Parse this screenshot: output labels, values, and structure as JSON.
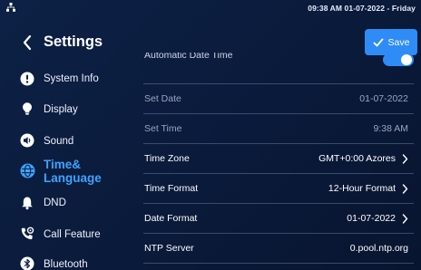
{
  "status_bar": {
    "network_icon": "network-icon",
    "datetime": "09:38 AM  01-07-2022 - Friday"
  },
  "header": {
    "back_icon": "chevron-left-icon",
    "title": "Settings",
    "save_label": "Save",
    "save_icon": "check-icon"
  },
  "sidebar": {
    "items": [
      {
        "label": "System Info",
        "icon": "info-icon"
      },
      {
        "label": "Display",
        "icon": "lightbulb-icon"
      },
      {
        "label": "Sound",
        "icon": "speaker-icon"
      },
      {
        "label": "Time& Language",
        "line1": "Time&",
        "line2": "Language",
        "icon": "globe-icon",
        "active": true
      },
      {
        "label": "DND",
        "icon": "bell-icon"
      },
      {
        "label": "Call Feature",
        "icon": "phone-settings-icon"
      },
      {
        "label": "Bluetooth",
        "icon": "bluetooth-icon"
      }
    ]
  },
  "content": {
    "partial_row": {
      "label": "Automatic Date Time",
      "toggle_on": true
    },
    "rows": [
      {
        "label": "Set Date",
        "value": "01-07-2022",
        "disabled": true,
        "chevron": false
      },
      {
        "label": "Set Time",
        "value": "9:38 AM",
        "disabled": true,
        "chevron": false
      },
      {
        "label": "Time Zone",
        "value": "GMT+0:00 Azores",
        "disabled": false,
        "chevron": true
      },
      {
        "label": "Time Format",
        "value": "12-Hour Format",
        "disabled": false,
        "chevron": true
      },
      {
        "label": "Date Format",
        "value": "01-07-2022",
        "disabled": false,
        "chevron": true
      },
      {
        "label": "NTP Server",
        "value": "0.pool.ntp.org",
        "disabled": false,
        "chevron": false
      }
    ]
  },
  "colors": {
    "background": "#0a1a38",
    "accent": "#2f8cf6",
    "active_text": "#3fa3ff",
    "dim_text": "#9aa6c0"
  }
}
